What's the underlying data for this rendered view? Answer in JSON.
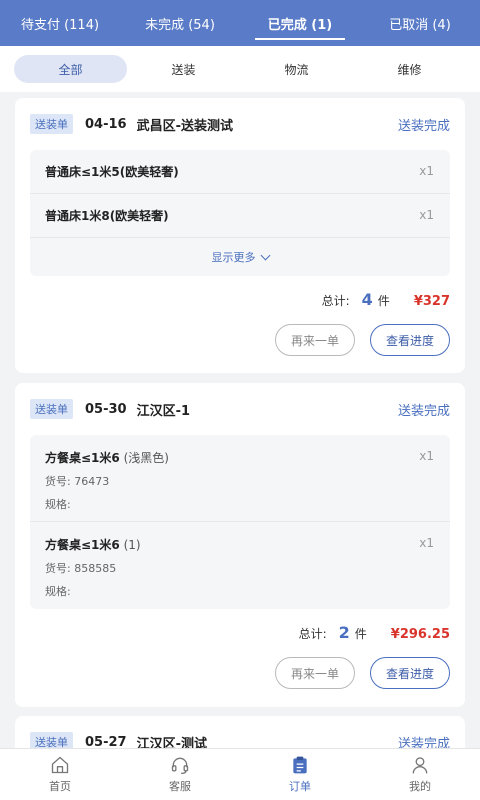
{
  "top_tabs": [
    {
      "label": "待支付 (114)"
    },
    {
      "label": "未完成 (54)"
    },
    {
      "label": "已完成 (1)"
    },
    {
      "label": "已取消 (4)"
    }
  ],
  "filters": [
    {
      "label": "全部"
    },
    {
      "label": "送装"
    },
    {
      "label": "物流"
    },
    {
      "label": "维修"
    }
  ],
  "orders": [
    {
      "tag": "送装单",
      "date": "04-16",
      "title": "武昌区-送装测试",
      "status": "送装完成",
      "items": [
        {
          "name": "普通床≤1米5(欧美轻奢)",
          "qty": "x1"
        },
        {
          "name": "普通床1米8(欧美轻奢)",
          "qty": "x1"
        }
      ],
      "show_more": "显示更多",
      "total_label": "总计:",
      "count": "4",
      "count_unit": "件",
      "price": "¥327",
      "btn_again": "再来一单",
      "btn_progress": "查看进度"
    },
    {
      "tag": "送装单",
      "date": "05-30",
      "title": "江汉区-1",
      "status": "送装完成",
      "items": [
        {
          "name": "方餐桌≤1米6",
          "extra": " (浅黑色)",
          "qty": "x1",
          "sku": "货号: 76473",
          "spec": "规格:"
        },
        {
          "name": "方餐桌≤1米6",
          "extra": " (1)",
          "qty": "x1",
          "sku": "货号: 858585",
          "spec": "规格:"
        }
      ],
      "total_label": "总计:",
      "count": "2",
      "count_unit": "件",
      "price": "¥296.25",
      "btn_again": "再来一单",
      "btn_progress": "查看进度"
    },
    {
      "tag": "送装单",
      "date": "05-27",
      "title": "江汉区-测试",
      "status": "送装完成"
    }
  ],
  "bottom_nav": [
    {
      "label": "首页",
      "icon": "home-icon"
    },
    {
      "label": "客服",
      "icon": "headset-icon"
    },
    {
      "label": "订单",
      "icon": "clipboard-icon"
    },
    {
      "label": "我的",
      "icon": "user-icon"
    }
  ],
  "colors": {
    "primary": "#5a7bc7",
    "accent_blue": "#4a6fbf",
    "price_red": "#d9342b"
  }
}
